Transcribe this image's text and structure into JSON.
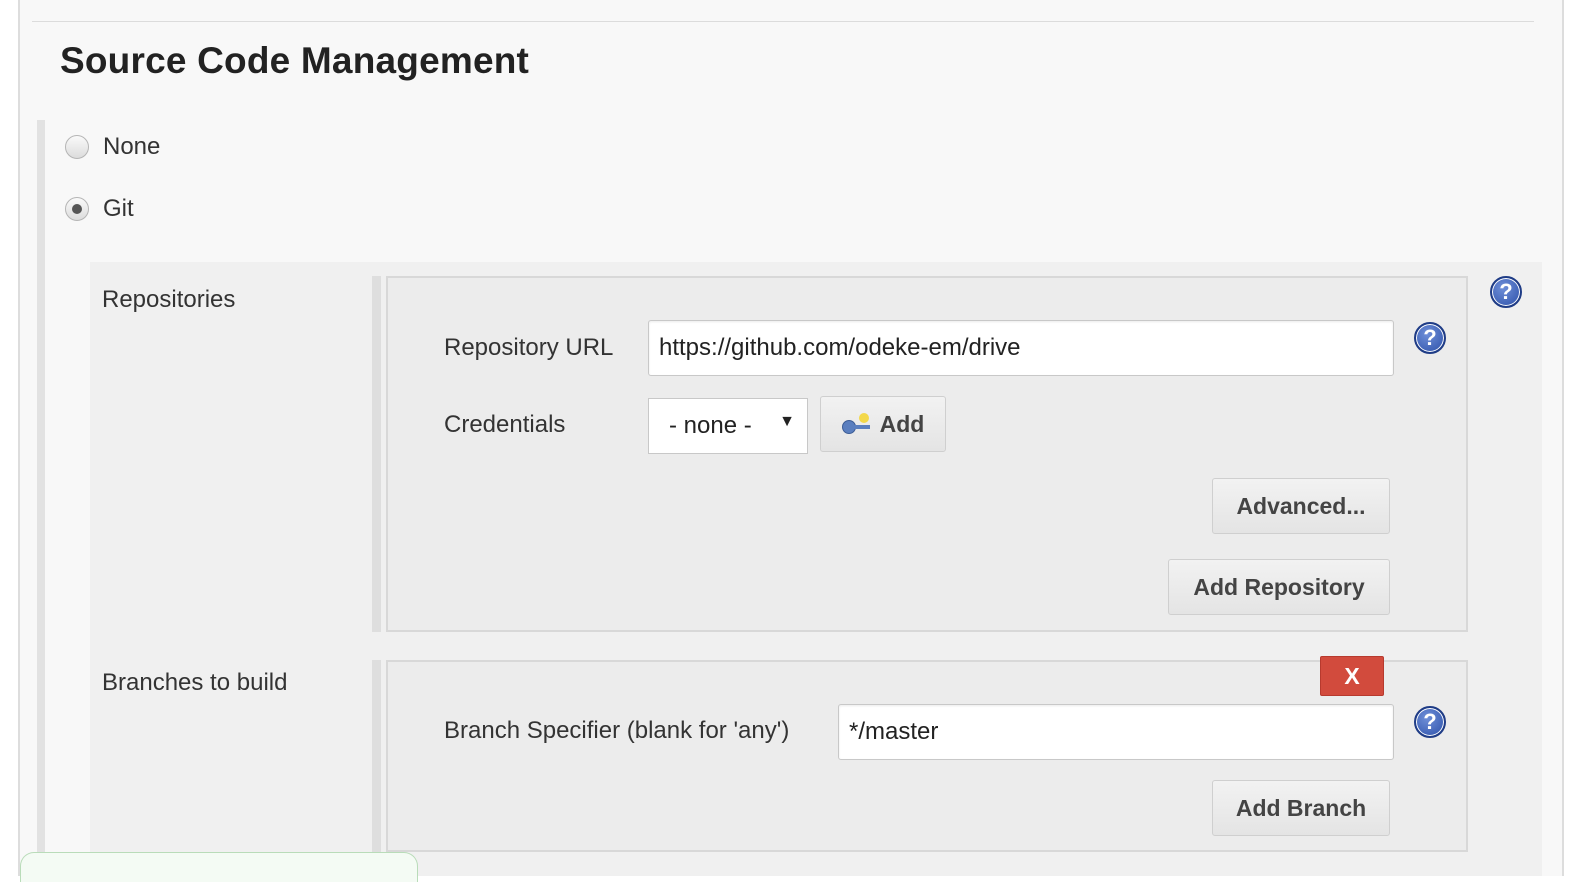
{
  "section": {
    "title": "Source Code Management"
  },
  "scm_options": [
    {
      "label": "None",
      "checked": false
    },
    {
      "label": "Git",
      "checked": true
    }
  ],
  "repositories": {
    "label": "Repositories",
    "repository_url_label": "Repository URL",
    "repository_url_value": "https://github.com/odeke-em/drive",
    "credentials_label": "Credentials",
    "credentials_selected": "- none -",
    "add_button": "Add",
    "advanced_button": "Advanced...",
    "add_repository_button": "Add Repository"
  },
  "branches": {
    "label": "Branches to build",
    "delete_button": "X",
    "branch_specifier_label": "Branch Specifier (blank for 'any')",
    "branch_specifier_value": "*/master",
    "add_branch_button": "Add Branch"
  },
  "help": {
    "glyph": "?"
  },
  "icons": {
    "help": "question-circle-icon",
    "key": "key-icon",
    "caret": "caret-down-icon"
  },
  "colors": {
    "delete_button": "#d24b3d",
    "help_icon": "#2b4fa8",
    "page_background": "#f8f8f8",
    "group_background": "#ececec"
  }
}
